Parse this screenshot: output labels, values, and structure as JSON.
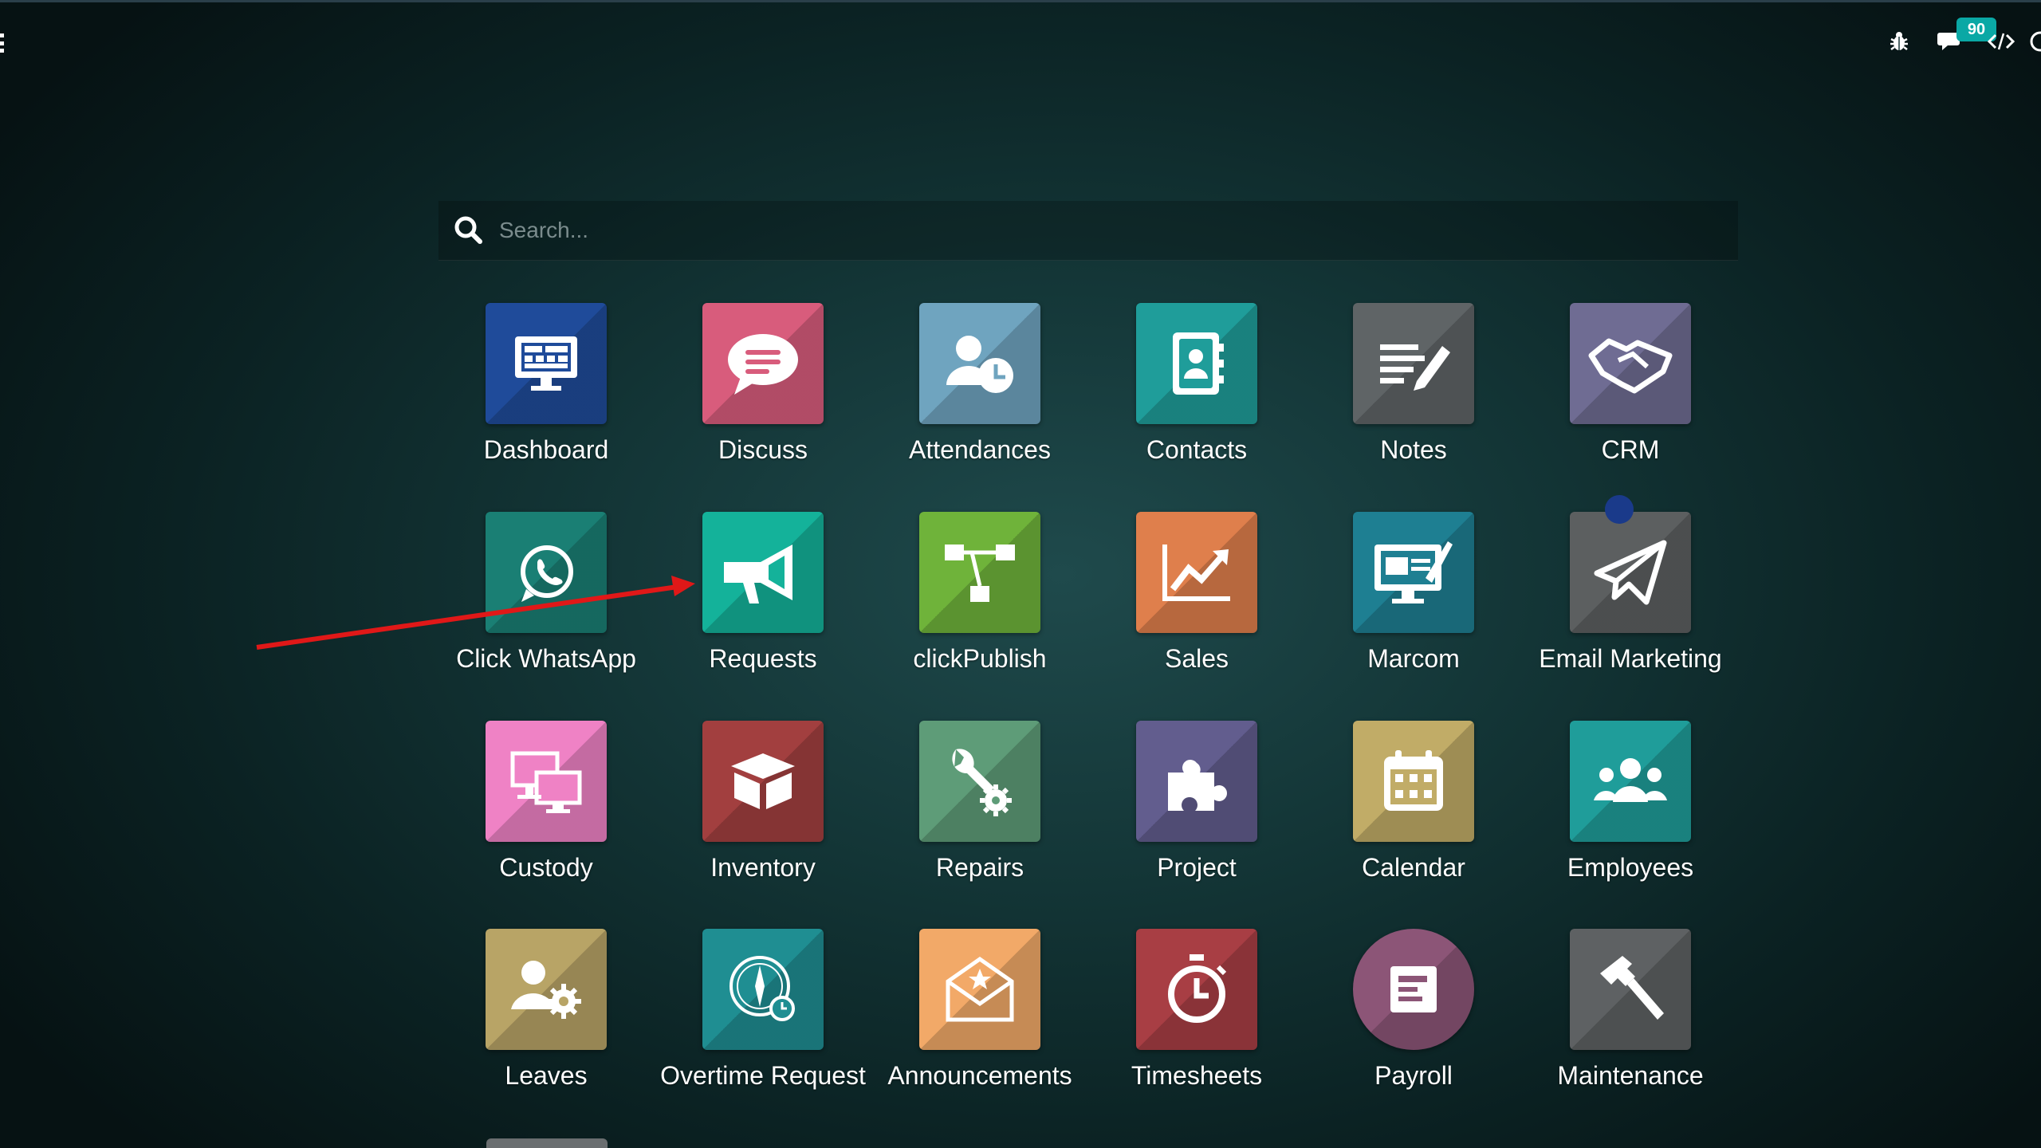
{
  "systray": {
    "messages_count": "90",
    "icons": [
      "bug-icon",
      "chat-icon",
      "code-icon",
      "clock-icon"
    ]
  },
  "search": {
    "placeholder": "Search..."
  },
  "apps": [
    {
      "label": "Dashboard",
      "icon": "dashboard-icon",
      "color": "#1f4b9a"
    },
    {
      "label": "Discuss",
      "icon": "chat-bubble-icon",
      "color": "#d85c7c"
    },
    {
      "label": "Attendances",
      "icon": "user-clock-icon",
      "color": "#6fa4bf"
    },
    {
      "label": "Contacts",
      "icon": "address-book-icon",
      "color": "#1f9d9a"
    },
    {
      "label": "Notes",
      "icon": "note-pencil-icon",
      "color": "#5f6466"
    },
    {
      "label": "CRM",
      "icon": "handshake-icon",
      "color": "#6f6c93"
    },
    {
      "label": "Click WhatsApp",
      "icon": "whatsapp-icon",
      "color": "#1a7f74"
    },
    {
      "label": "Requests",
      "icon": "megaphone-icon",
      "color": "#14b29a"
    },
    {
      "label": "clickPublish",
      "icon": "flow-nodes-icon",
      "color": "#6fb33a"
    },
    {
      "label": "Sales",
      "icon": "chart-up-icon",
      "color": "#df7f4c"
    },
    {
      "label": "Marcom",
      "icon": "monitor-brush-icon",
      "color": "#1e7f92"
    },
    {
      "label": "Email Marketing",
      "icon": "paper-plane-icon",
      "color": "#5c5f60"
    },
    {
      "label": "Custody",
      "icon": "screens-icon",
      "color": "#ef82c5"
    },
    {
      "label": "Inventory",
      "icon": "box-icon",
      "color": "#a23f3f"
    },
    {
      "label": "Repairs",
      "icon": "wrench-gear-icon",
      "color": "#5e9c78"
    },
    {
      "label": "Project",
      "icon": "puzzle-icon",
      "color": "#625d8e"
    },
    {
      "label": "Calendar",
      "icon": "calendar-icon",
      "color": "#c1ac67"
    },
    {
      "label": "Employees",
      "icon": "users-icon",
      "color": "#1f9d9a"
    },
    {
      "label": "Leaves",
      "icon": "user-gear-icon",
      "color": "#b8a466"
    },
    {
      "label": "Overtime Request",
      "icon": "clock-compass-icon",
      "color": "#1f8e92"
    },
    {
      "label": "Announcements",
      "icon": "envelope-star-icon",
      "color": "#f2a968"
    },
    {
      "label": "Timesheets",
      "icon": "stopwatch-icon",
      "color": "#a83e44"
    },
    {
      "label": "Payroll",
      "icon": "payslip-icon",
      "color": "#8c5577"
    },
    {
      "label": "Maintenance",
      "icon": "hammer-icon",
      "color": "#5e6163"
    }
  ]
}
